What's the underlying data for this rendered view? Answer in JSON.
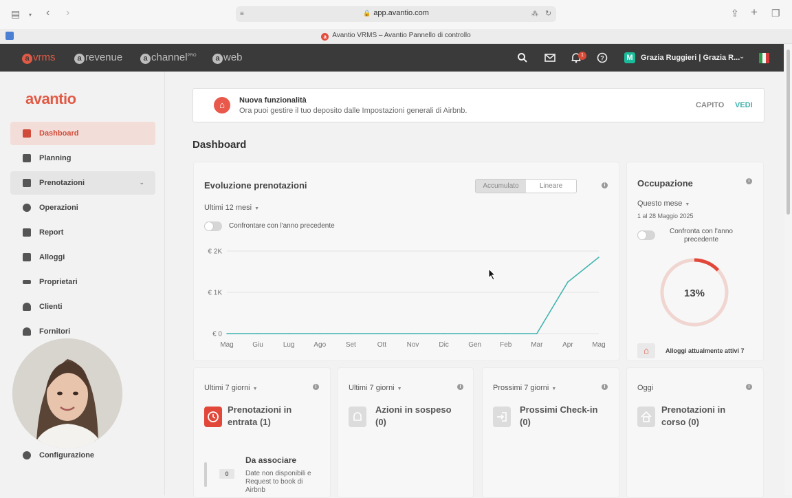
{
  "browser": {
    "url": "app.avantio.com",
    "tab_title": "Avantio VRMS – Avantio Pannello di controllo",
    "tab_favicon": "a"
  },
  "topnav": {
    "brands": [
      {
        "letter": "a",
        "name": "vrms",
        "active": true
      },
      {
        "letter": "a",
        "name": "revenue",
        "active": false
      },
      {
        "letter": "a",
        "name": "channel",
        "sup": "PRO",
        "active": false
      },
      {
        "letter": "a",
        "name": "web",
        "active": false
      }
    ],
    "notifications_count": "1",
    "user_initial": "M",
    "user_name": "Grazia Ruggieri | Grazia R..."
  },
  "sidebar": {
    "logo": "avantio",
    "items": [
      {
        "label": "Dashboard",
        "icon": "dashboard-icon"
      },
      {
        "label": "Planning",
        "icon": "calendar-icon"
      },
      {
        "label": "Prenotazioni",
        "icon": "bookings-icon"
      },
      {
        "label": "Operazioni",
        "icon": "check-circle-icon"
      },
      {
        "label": "Report",
        "icon": "report-icon"
      },
      {
        "label": "Alloggi",
        "icon": "building-icon"
      },
      {
        "label": "Proprietari",
        "icon": "key-icon"
      },
      {
        "label": "Clienti",
        "icon": "user-icon"
      },
      {
        "label": "Fornitori",
        "icon": "users-icon"
      },
      {
        "label": "Configurazione",
        "icon": "gear-icon"
      }
    ]
  },
  "notice": {
    "title": "Nuova funzionalità",
    "text": "Ora puoi gestire il tuo deposito dalle Impostazioni generali di Airbnb.",
    "dismiss": "CAPITO",
    "view": "VEDI"
  },
  "page_title": "Dashboard",
  "evolution": {
    "title": "Evoluzione prenotazioni",
    "seg_accumulated": "Accumulato",
    "seg_linear": "Lineare",
    "period": "Ultimi 12 mesi",
    "compare": "Confrontare con l'anno precedente"
  },
  "chart_data": {
    "type": "line",
    "title": "Evoluzione prenotazioni",
    "categories": [
      "Mag",
      "Giu",
      "Lug",
      "Ago",
      "Set",
      "Ott",
      "Nov",
      "Dic",
      "Gen",
      "Feb",
      "Mar",
      "Apr",
      "Mag"
    ],
    "y_ticks": [
      "€ 0",
      "€ 1K",
      "€ 2K"
    ],
    "ylim": [
      0,
      2000
    ],
    "series": [
      {
        "values": [
          0,
          0,
          0,
          0,
          0,
          0,
          0,
          0,
          0,
          0,
          0,
          1250,
          1850
        ],
        "color": "#3fb3ae"
      }
    ],
    "grid": true
  },
  "occupancy": {
    "title": "Occupazione",
    "period": "Questo mese",
    "range": "1 al 28 Maggio 2025",
    "compare_line1": "Confronta con l'anno",
    "compare_line2": "precedente",
    "percent_label": "13%",
    "percent_value": 0.13,
    "active_units": "Alloggi attualmente attivi 7"
  },
  "bottom_cards": [
    {
      "period": "Ultimi 7 giorni",
      "line1": "Prenotazioni in",
      "line2": "entrata (1)",
      "icon": "clock-icon"
    },
    {
      "period": "Ultimi 7 giorni",
      "line1": "Azioni in sospeso",
      "line2": "(0)",
      "icon": "bell-icon"
    },
    {
      "period": "Prossimi 7 giorni",
      "line1": "Prossimi Check-in",
      "line2": "(0)",
      "icon": "checkin-icon"
    },
    {
      "period": "Oggi",
      "line1": "Prenotazioni in",
      "line2": "corso (0)",
      "icon": "home-icon"
    }
  ],
  "to_associate": {
    "title": "Da associare",
    "count": "0",
    "line1": "Date non disponibili e",
    "line2": "Request to book di",
    "line3": "Airbnb"
  },
  "colors": {
    "accent": "#e05a45",
    "teal": "#3fb3ae",
    "nav_bg": "#3a3a3a"
  }
}
